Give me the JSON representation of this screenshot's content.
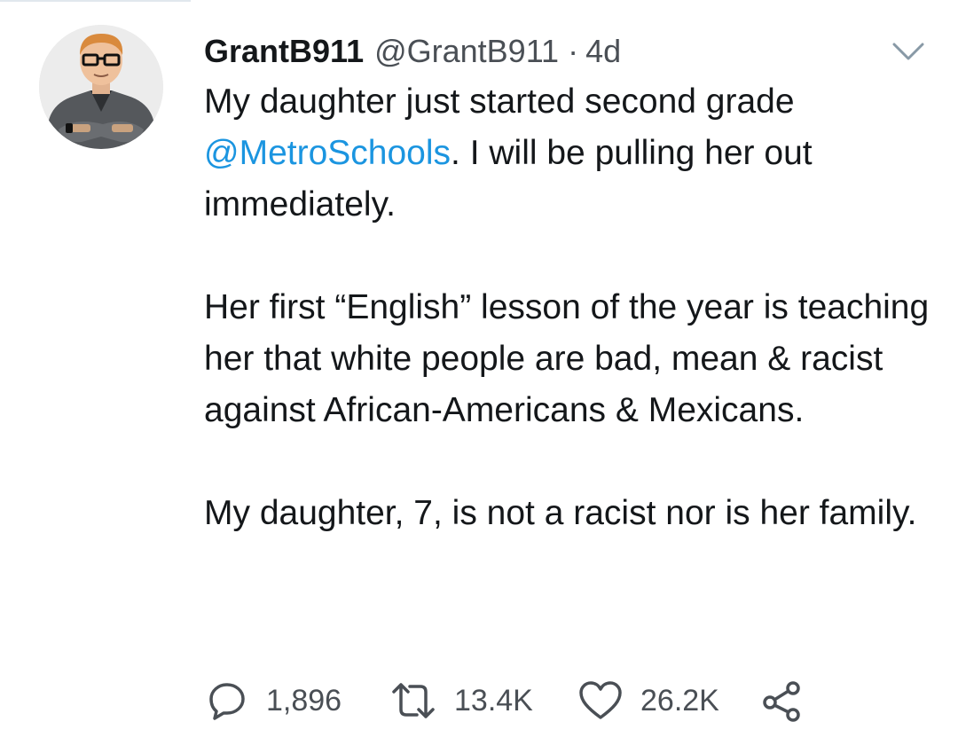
{
  "tweet": {
    "display_name": "GrantB911",
    "handle": "@GrantB911",
    "separator": "·",
    "time": "4d",
    "line1_a": "My daughter just started second grade",
    "mention": "@MetroSchools",
    "line1_b": ". I will be pulling her out immediately.",
    "paragraph2": "Her first “English” lesson of the year is teaching her that white people are bad, mean & racist against African-Americans & Mexicans.",
    "paragraph3": "My daughter, 7, is not a racist nor is her family."
  },
  "actions": {
    "replies": "1,896",
    "retweets": "13.4K",
    "likes": "26.2K"
  },
  "icons": {
    "reply": "reply-icon",
    "retweet": "retweet-icon",
    "like": "heart-icon",
    "share": "share-icon",
    "caret": "chevron-down-icon"
  },
  "colors": {
    "mention": "#1b95e0",
    "secondary_text": "#4a4f55",
    "primary_text": "#14171a"
  }
}
